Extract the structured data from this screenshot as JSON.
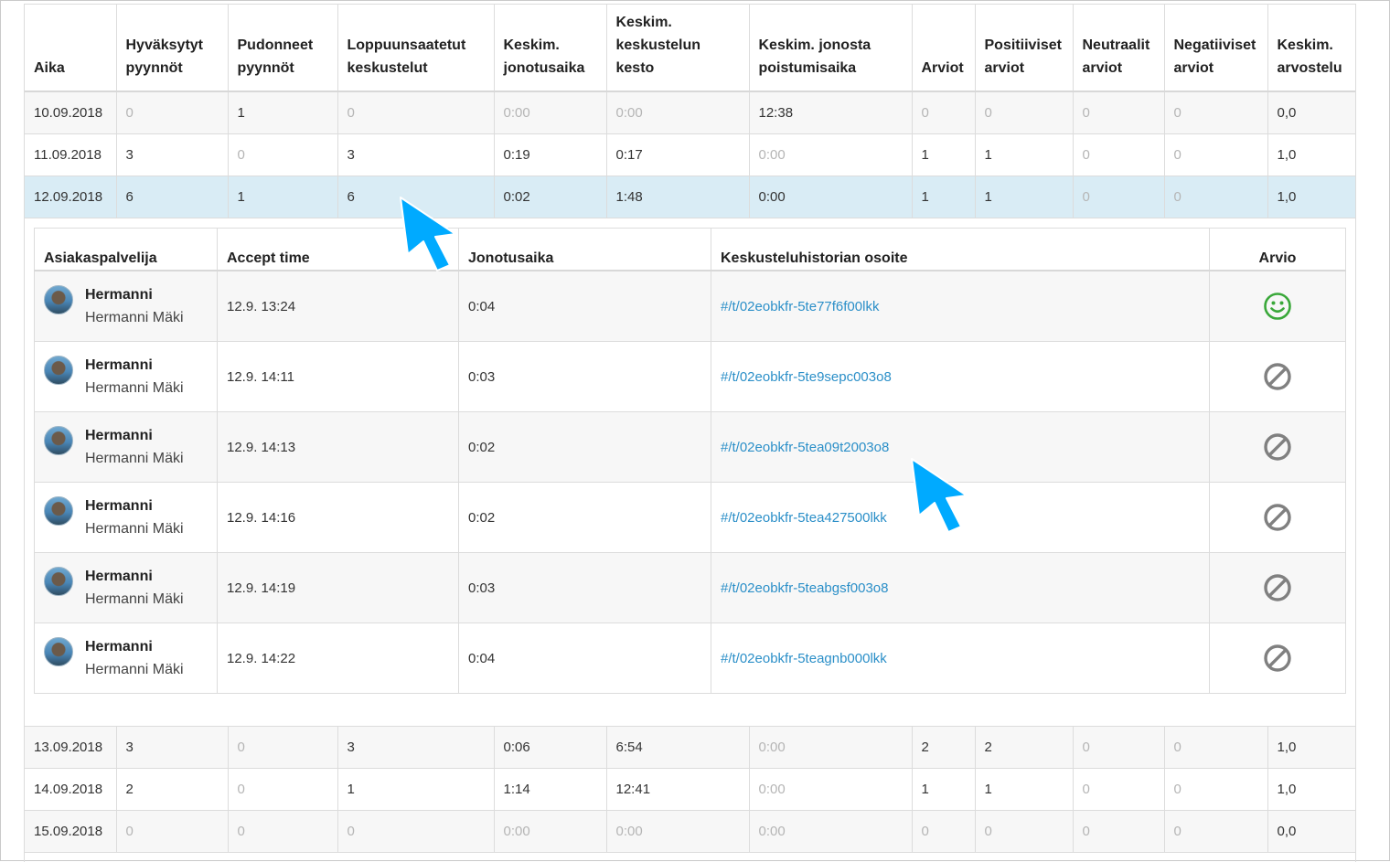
{
  "colors": {
    "accent": "#00aaff",
    "link": "#2b8fc8",
    "selected_row": "#d9ecf5",
    "positive": "#3aa83a",
    "muted": "#808080"
  },
  "main_table": {
    "headers": [
      [
        "Aika"
      ],
      [
        "Hyväksytyt",
        "pyynnöt"
      ],
      [
        "Pudonneet",
        "pyynnöt"
      ],
      [
        "Loppuunsaatetut",
        "keskustelut"
      ],
      [
        "Keskim.",
        "jonotusaika"
      ],
      [
        "Keskim.",
        "keskustelun",
        "kesto"
      ],
      [
        "Keskim. jonosta",
        "poistumisaika"
      ],
      [
        "Arviot"
      ],
      [
        "Positiiviset",
        "arviot"
      ],
      [
        "Neutraalit",
        "arviot"
      ],
      [
        "Negatiiviset",
        "arviot"
      ],
      [
        "Keskim.",
        "arvostelu"
      ]
    ],
    "rows_before": [
      [
        "10.09.2018",
        "0",
        "1",
        "0",
        "0:00",
        "0:00",
        "12:38",
        "0",
        "0",
        "0",
        "0",
        "0,0"
      ],
      [
        "11.09.2018",
        "3",
        "0",
        "3",
        "0:19",
        "0:17",
        "0:00",
        "1",
        "1",
        "0",
        "0",
        "1,0"
      ],
      [
        "12.09.2018",
        "6",
        "1",
        "6",
        "0:02",
        "1:48",
        "0:00",
        "1",
        "1",
        "0",
        "0",
        "1,0"
      ]
    ],
    "rows_before_muted": [
      [
        false,
        true,
        false,
        true,
        true,
        true,
        false,
        true,
        true,
        true,
        true,
        false
      ],
      [
        false,
        false,
        true,
        false,
        false,
        false,
        true,
        false,
        false,
        true,
        true,
        false
      ],
      [
        false,
        false,
        false,
        false,
        false,
        false,
        false,
        false,
        false,
        true,
        true,
        false
      ]
    ],
    "rows_after": [
      [
        "13.09.2018",
        "3",
        "0",
        "3",
        "0:06",
        "6:54",
        "0:00",
        "2",
        "2",
        "0",
        "0",
        "1,0"
      ],
      [
        "14.09.2018",
        "2",
        "0",
        "1",
        "1:14",
        "12:41",
        "0:00",
        "1",
        "1",
        "0",
        "0",
        "1,0"
      ],
      [
        "15.09.2018",
        "0",
        "0",
        "0",
        "0:00",
        "0:00",
        "0:00",
        "0",
        "0",
        "0",
        "0",
        "0,0"
      ]
    ],
    "rows_after_muted": [
      [
        false,
        false,
        true,
        false,
        false,
        false,
        true,
        false,
        false,
        true,
        true,
        false
      ],
      [
        false,
        false,
        true,
        false,
        false,
        false,
        true,
        false,
        false,
        true,
        true,
        false
      ],
      [
        false,
        true,
        true,
        true,
        true,
        true,
        true,
        true,
        true,
        true,
        true,
        false
      ]
    ]
  },
  "detail_table": {
    "headers": [
      "Asiakaspalvelija",
      "Accept time",
      "Jonotusaika",
      "Keskusteluhistorian osoite",
      "Arvio"
    ],
    "rows": [
      {
        "first_name": "Hermanni",
        "full_name": "Hermanni Mäki",
        "accept_time": "12.9. 13:24",
        "queue_time": "0:04",
        "history_link": "#/t/02eobkfr-5te77f6f00lkk",
        "rating_icon": "smiley-icon"
      },
      {
        "first_name": "Hermanni",
        "full_name": "Hermanni Mäki",
        "accept_time": "12.9. 14:11",
        "queue_time": "0:03",
        "history_link": "#/t/02eobkfr-5te9sepc003o8",
        "rating_icon": "no-rating-icon"
      },
      {
        "first_name": "Hermanni",
        "full_name": "Hermanni Mäki",
        "accept_time": "12.9. 14:13",
        "queue_time": "0:02",
        "history_link": "#/t/02eobkfr-5tea09t2003o8",
        "rating_icon": "no-rating-icon"
      },
      {
        "first_name": "Hermanni",
        "full_name": "Hermanni Mäki",
        "accept_time": "12.9. 14:16",
        "queue_time": "0:02",
        "history_link": "#/t/02eobkfr-5tea427500lkk",
        "rating_icon": "no-rating-icon"
      },
      {
        "first_name": "Hermanni",
        "full_name": "Hermanni Mäki",
        "accept_time": "12.9. 14:19",
        "queue_time": "0:03",
        "history_link": "#/t/02eobkfr-5teabgsf003o8",
        "rating_icon": "no-rating-icon"
      },
      {
        "first_name": "Hermanni",
        "full_name": "Hermanni Mäki",
        "accept_time": "12.9. 14:22",
        "queue_time": "0:04",
        "history_link": "#/t/02eobkfr-5teagnb000lkk",
        "rating_icon": "no-rating-icon"
      }
    ]
  }
}
